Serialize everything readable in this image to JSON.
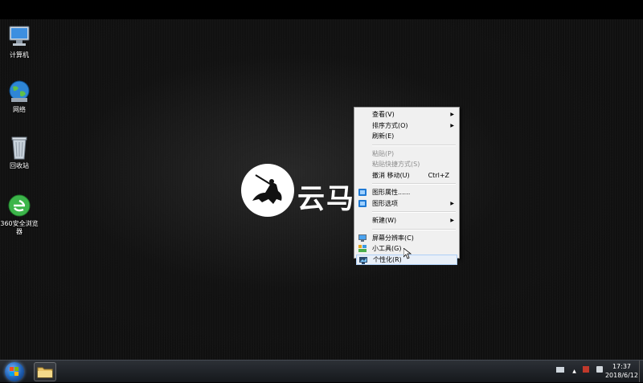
{
  "desktop": {
    "icons": [
      {
        "label": "计算机",
        "icon": "computer-icon"
      },
      {
        "label": "网络",
        "icon": "network-icon"
      },
      {
        "label": "回收站",
        "icon": "recycle-bin-icon"
      },
      {
        "label_line1": "360安全浏览",
        "label_line2": "器",
        "icon": "360-browser-icon"
      }
    ],
    "logo_text": "云马"
  },
  "context_menu": {
    "items": [
      {
        "label": "查看(V)",
        "submenu": true
      },
      {
        "label": "排序方式(O)",
        "submenu": true
      },
      {
        "label": "刷新(E)"
      },
      {
        "label": "粘贴(P)",
        "disabled": true
      },
      {
        "label": "粘贴快捷方式(S)",
        "disabled": true
      },
      {
        "label": "撤消 移动(U)",
        "shortcut": "Ctrl+Z"
      },
      {
        "label": "图形属性......",
        "icon": "intel-graphics-icon"
      },
      {
        "label": "图形选项",
        "icon": "intel-graphics-icon",
        "submenu": true
      },
      {
        "label": "新建(W)",
        "submenu": true
      },
      {
        "label": "屏幕分辨率(C)",
        "icon": "display-icon"
      },
      {
        "label": "小工具(G)",
        "icon": "gadgets-icon"
      },
      {
        "label": "个性化(R)",
        "icon": "personalize-icon",
        "highlighted": true
      }
    ],
    "arrow": "▶"
  },
  "taskbar": {
    "time": "17:37",
    "date": "2018/6/12",
    "tray_up_arrow": "▲"
  },
  "colors": {
    "menu_bg": "#f0f0f0",
    "highlight_bg": "#e8eff8",
    "taskbar": "#1c1f23"
  }
}
